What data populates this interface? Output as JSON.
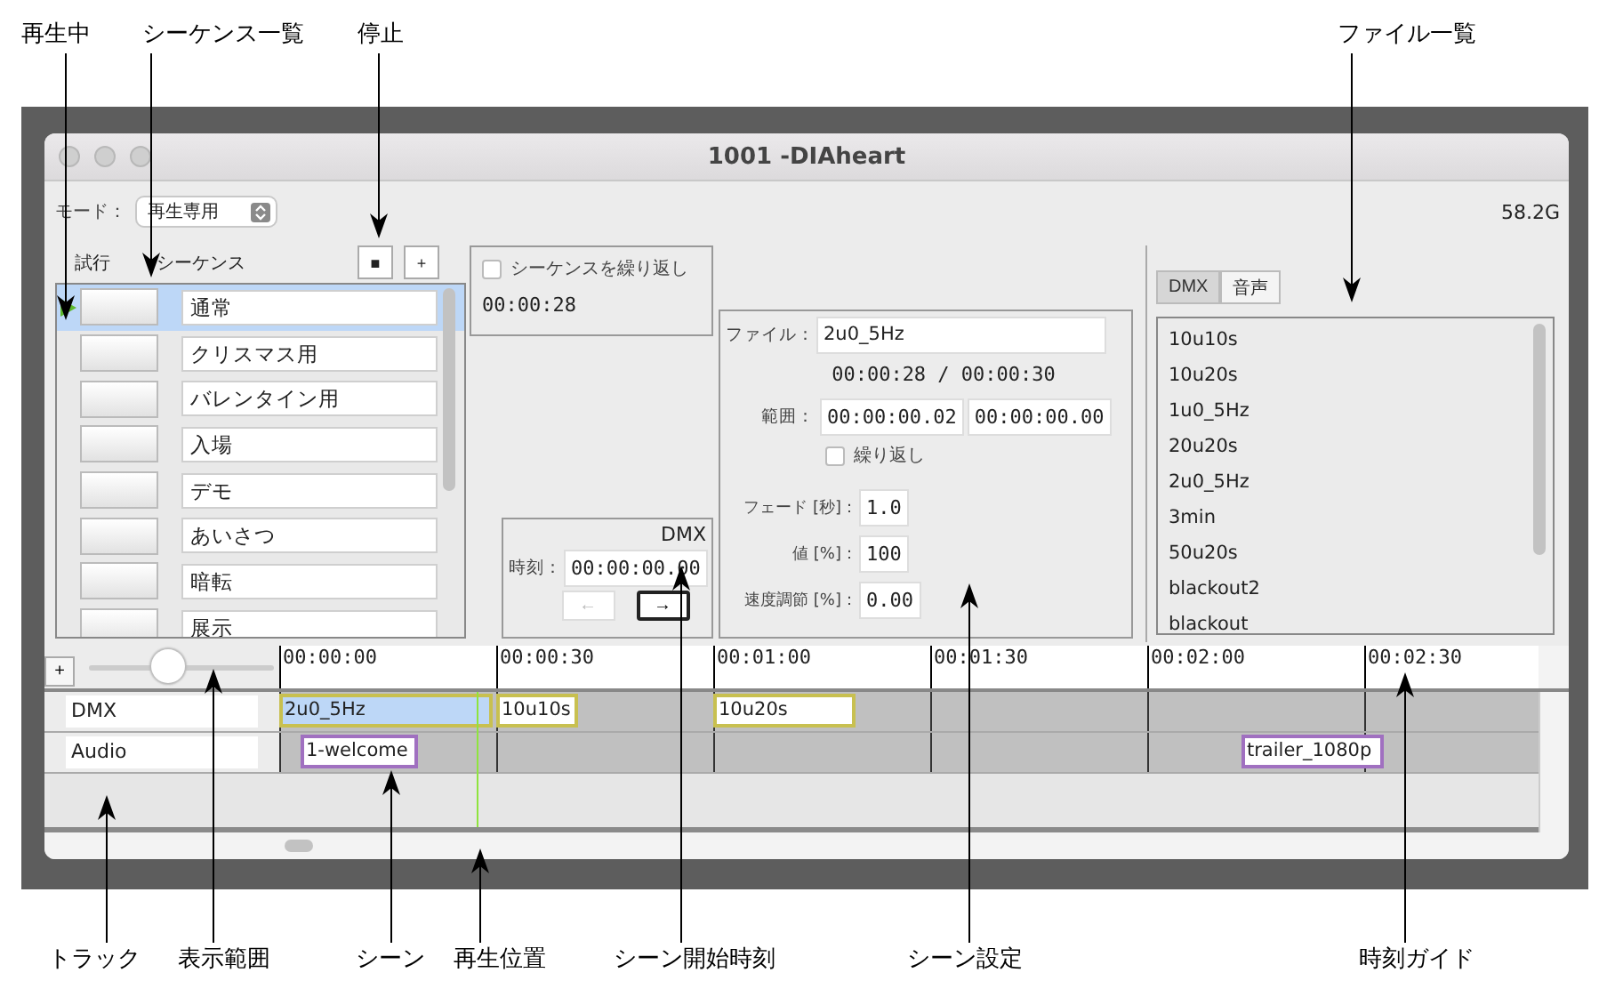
{
  "callouts_top": [
    {
      "label": "再生中"
    },
    {
      "label": "シーケンス一覧"
    },
    {
      "label": "停止"
    },
    {
      "label": "ファイル一覧"
    }
  ],
  "callouts_bottom": [
    {
      "label": "トラック"
    },
    {
      "label": "表示範囲"
    },
    {
      "label": "シーン"
    },
    {
      "label": "再生位置"
    },
    {
      "label": "シーン開始時刻"
    },
    {
      "label": "シーン設定"
    },
    {
      "label": "時刻ガイド"
    }
  ],
  "window": {
    "title": "1001 -DIAheart"
  },
  "mode": {
    "label": "モード：",
    "value": "再生専用"
  },
  "storage": "58.2G",
  "sequence_list": {
    "headers": [
      "試行",
      "シーケンス"
    ],
    "stop_button": "■",
    "add_button": "+",
    "items": [
      {
        "name": "通常",
        "selected": true,
        "playing": true
      },
      {
        "name": "クリスマス用",
        "selected": false,
        "playing": false
      },
      {
        "name": "バレンタイン用",
        "selected": false,
        "playing": false
      },
      {
        "name": "入場",
        "selected": false,
        "playing": false
      },
      {
        "name": "デモ",
        "selected": false,
        "playing": false
      },
      {
        "name": "あいさつ",
        "selected": false,
        "playing": false
      },
      {
        "name": "暗転",
        "selected": false,
        "playing": false
      },
      {
        "name": "展示",
        "selected": false,
        "playing": false
      }
    ]
  },
  "repeat_panel": {
    "checkbox": {
      "label": "シーケンスを繰り返し",
      "checked": false
    },
    "time": "00:00:28"
  },
  "dmx_panel": {
    "title": "DMX",
    "time_label": "時刻：",
    "time": "00:00:00.00",
    "prev_button": {
      "label": "←",
      "disabled": true
    },
    "next_button": {
      "label": "→",
      "disabled": false
    }
  },
  "scene_settings": {
    "file_label": "ファイル：",
    "file": "2u0_5Hz",
    "position": "00:00:28 / 00:00:30",
    "range_label": "範囲：",
    "range_start": "00:00:00.02",
    "range_end": "00:00:00.00",
    "loop": {
      "label": "繰り返し",
      "checked": false
    },
    "fields": [
      {
        "label": "フェード [秒]：",
        "value": "1.0"
      },
      {
        "label": "値 [%]：",
        "value": "100"
      },
      {
        "label": "速度調節 [%]：",
        "value": "0.00"
      }
    ]
  },
  "file_browser": {
    "tabs": [
      {
        "label": "DMX",
        "selected": true
      },
      {
        "label": "音声",
        "selected": false
      }
    ],
    "files": [
      "10u10s",
      "10u20s",
      "1u0_5Hz",
      "20u20s",
      "2u0_5Hz",
      "3min",
      "50u20s",
      "blackout2",
      "blackout"
    ]
  },
  "timeline": {
    "add_button": "+",
    "zoom": {
      "level": 0.4
    },
    "ticks": [
      "00:00:00",
      "00:00:30",
      "00:01:00",
      "00:01:30",
      "00:02:00",
      "00:02:30"
    ],
    "tracks": [
      {
        "name": "DMX",
        "kind": "dmx",
        "scenes": [
          {
            "name": "2u0_5Hz",
            "selected": true
          },
          {
            "name": "10u10s",
            "selected": false
          },
          {
            "name": "10u20s",
            "selected": false
          }
        ]
      },
      {
        "name": "Audio",
        "kind": "audio",
        "scenes": [
          {
            "name": "1-welcome",
            "selected": false
          },
          {
            "name": "trailer_1080p",
            "selected": false
          }
        ]
      }
    ]
  }
}
